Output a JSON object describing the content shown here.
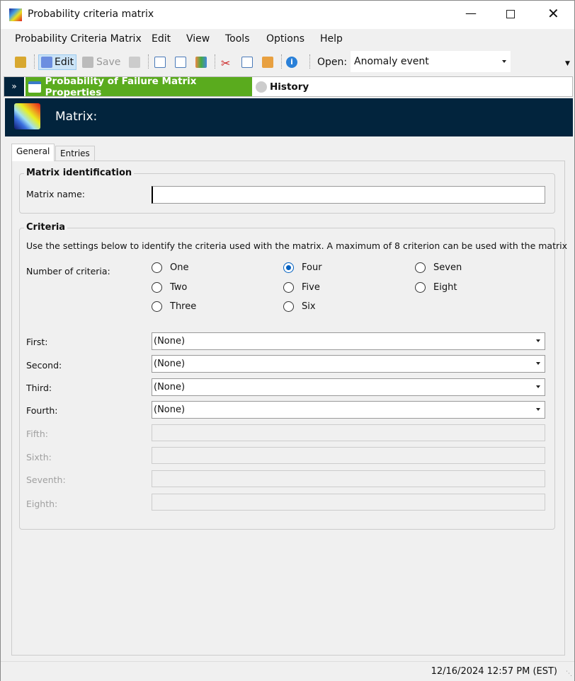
{
  "window": {
    "title": "Probability criteria matrix"
  },
  "menu": [
    "Probability Criteria Matrix",
    "Edit",
    "View",
    "Tools",
    "Options",
    "Help"
  ],
  "toolbar": {
    "edit": "Edit",
    "save": "Save",
    "open_label": "Open:",
    "open_value": "Anomaly event"
  },
  "panel": {
    "properties_tab": "Probability of Failure Matrix Properties",
    "history_tab": "History"
  },
  "banner": {
    "title": "Matrix:"
  },
  "tabs": [
    "General",
    "Entries"
  ],
  "identification": {
    "title": "Matrix identification",
    "name_label": "Matrix name:",
    "name_value": ""
  },
  "criteria": {
    "title": "Criteria",
    "description": "Use the settings below to identify the criteria used with the matrix.   A maximum of 8 criterion can be used with the matrix",
    "count_label": "Number of criteria:",
    "options": [
      "One",
      "Two",
      "Three",
      "Four",
      "Five",
      "Six",
      "Seven",
      "Eight"
    ],
    "selected": "Four",
    "fields": [
      {
        "label": "First:",
        "value": "(None)"
      },
      {
        "label": "Second:",
        "value": "(None)"
      },
      {
        "label": "Third:",
        "value": "(None)"
      },
      {
        "label": "Fourth:",
        "value": "(None)"
      },
      {
        "label": "Fifth:",
        "value": ""
      },
      {
        "label": "Sixth:",
        "value": ""
      },
      {
        "label": "Seventh:",
        "value": ""
      },
      {
        "label": "Eighth:",
        "value": ""
      }
    ]
  },
  "status": {
    "datetime": "12/16/2024 12:57 PM (EST)"
  }
}
